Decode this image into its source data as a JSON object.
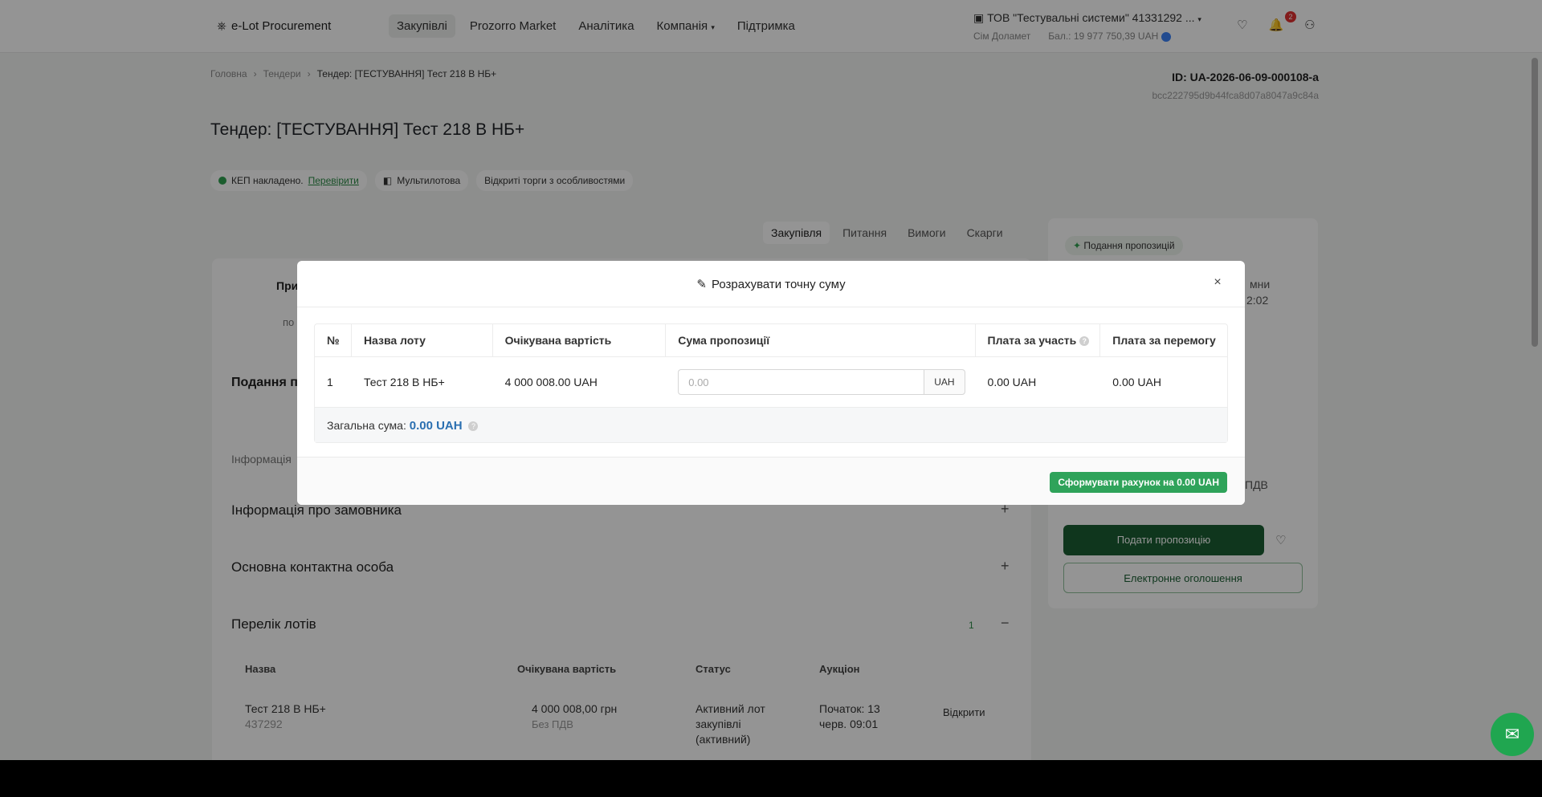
{
  "header": {
    "logo": "e-Lot Procurement",
    "nav": [
      "Закупівлі",
      "Prozorro Market",
      "Аналітика",
      "Компанія",
      "Підтримка"
    ],
    "org_name": "ТОВ \"Тестувальні системи\" 41331292 ...",
    "org_user": "Сім Доламет",
    "balance": "Бал.: 19 977 750,39 UAH",
    "notifications_count": "2"
  },
  "breadcrumb": [
    "Головна",
    "Тендери",
    "Тендер: [ТЕСТУВАННЯ] Тест 218 В НБ+"
  ],
  "tender": {
    "id": "ID: UA-2026-06-09-000108-a",
    "hash": "bcc222795d9b44fca8d07a8047a9c84a",
    "title": "Тендер: [ТЕСТУВАННЯ] Тест 218 В НБ+",
    "kep": "КЕП накладено.",
    "kep_check": "Перевірити",
    "multilot": "Мультилотова",
    "procedure": "Відкриті торги з особливостями"
  },
  "section_tabs": [
    "Закупівля",
    "Питання",
    "Вимоги",
    "Скарги"
  ],
  "left": {
    "tab_peek": "При",
    "tab_sub_peek": "по",
    "submission_peek": "Подання пр",
    "info_peek": "Інформація",
    "acc_customer": "Інформація про замовника",
    "acc_contact": "Основна контактна особа",
    "acc_lots": "Перелік лотів",
    "lots_count": "1",
    "lots_table": {
      "headers": [
        "Назва",
        "Очікувана вартість",
        "Статус",
        "Аукціон"
      ],
      "row": {
        "name": "Тест 218 В НБ+",
        "code": "437292",
        "value": "4 000 008,00 грн",
        "vat": "Без ПДВ",
        "status": "Активний лот закупівлі (активний)",
        "auction": "Початок: 13 черв. 09:01",
        "open": "Відкрити"
      }
    }
  },
  "right": {
    "stage": "Подання пропозицій",
    "peek_1": "мни",
    "peek_2": "2:02",
    "peek_3": "ПДВ",
    "submit": "Подати пропозицію",
    "announce": "Електронне оголошення"
  },
  "modal": {
    "title": "Розрахувати точну суму",
    "columns": [
      "№",
      "Назва лоту",
      "Очікувана вартість",
      "Сума пропозиції",
      "Плата за участь",
      "Плата за перемогу"
    ],
    "row": {
      "num": "1",
      "lot": "Тест 218 В НБ+",
      "expected": "4 000 008.00 UAH",
      "amount_placeholder": "0.00",
      "currency": "UAH",
      "fee_participation": "0.00 UAH",
      "fee_win": "0.00 UAH"
    },
    "total_label": "Загальна сума:",
    "total_value": "0.00 UAH",
    "invoice_button": "Сформувати рахунок на 0.00 UAH"
  }
}
